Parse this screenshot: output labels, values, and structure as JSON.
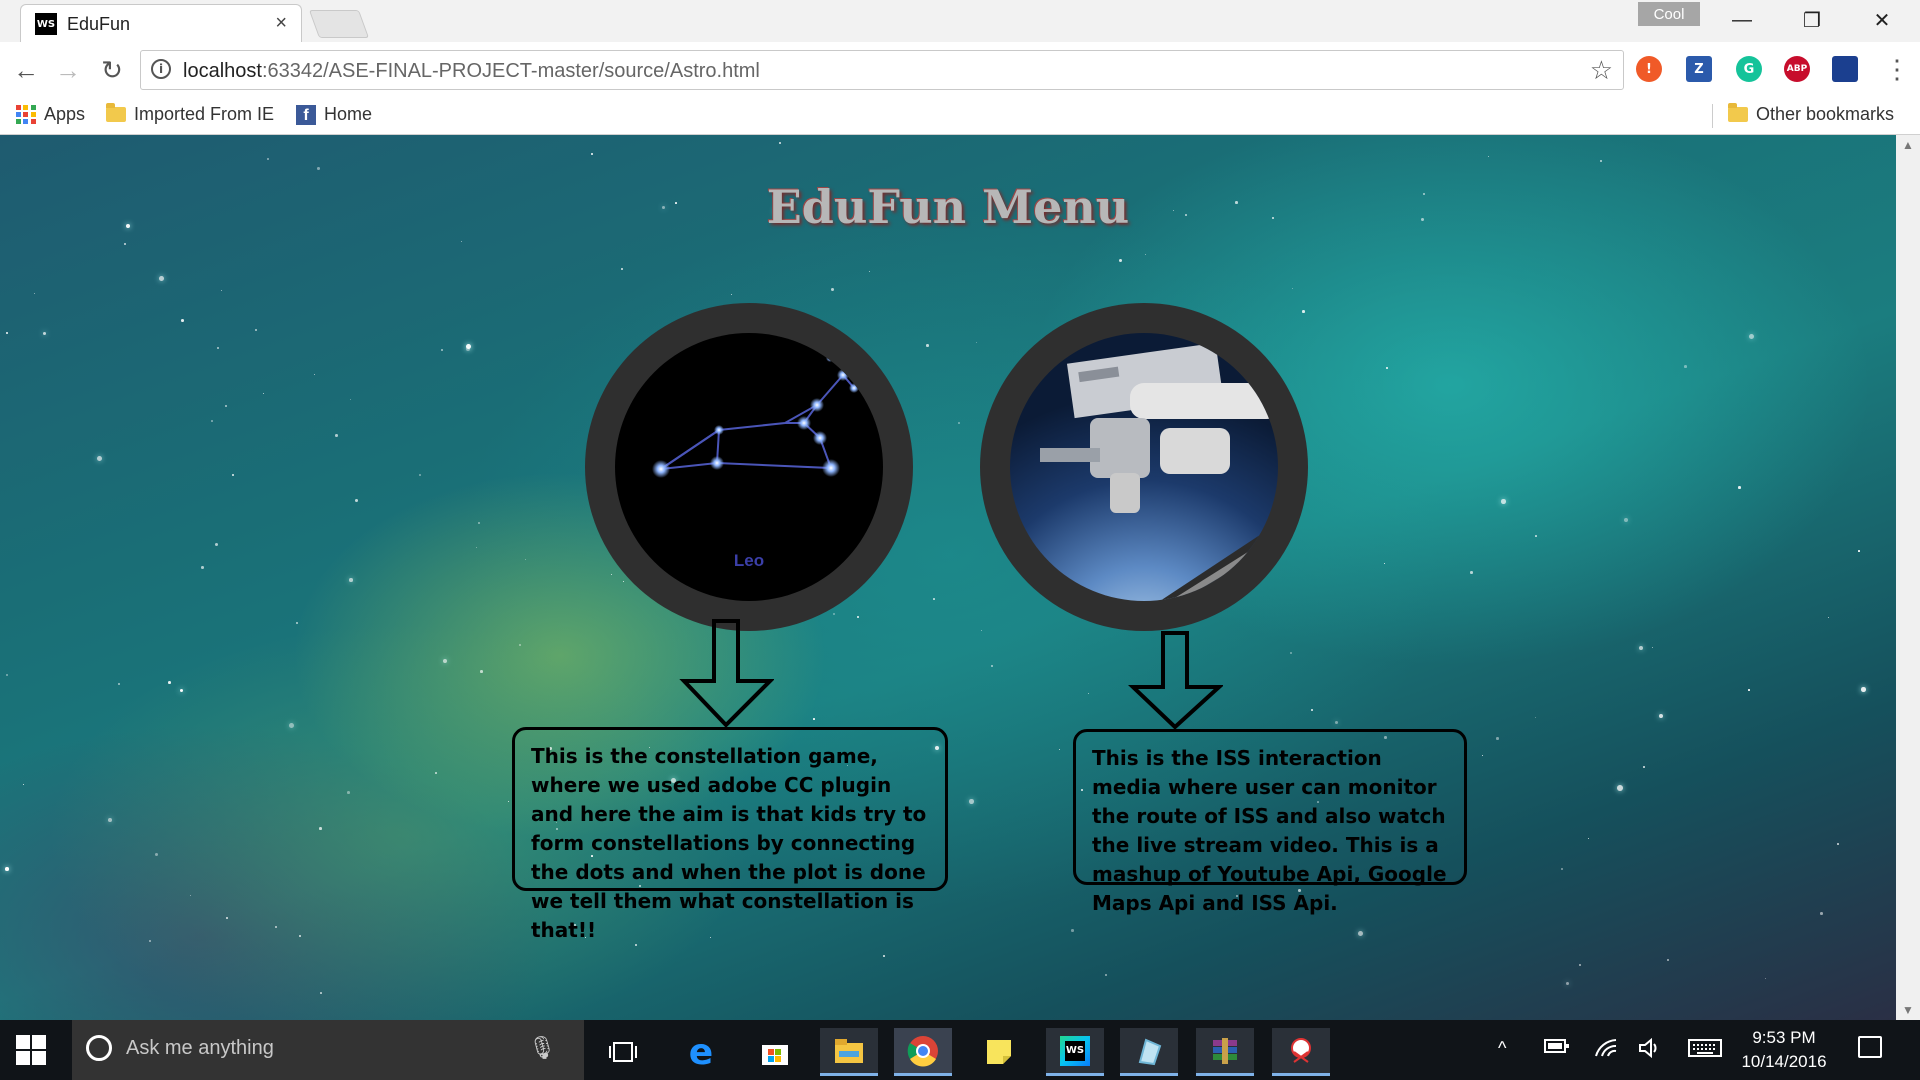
{
  "window": {
    "tab_title": "EduFun",
    "tab_favicon": "WS",
    "tab_close": "×",
    "profile_name": "Cool",
    "controls": {
      "minimize": "—",
      "restore": "❐",
      "close": "✕"
    }
  },
  "toolbar": {
    "url_host": "localhost",
    "url_rest": ":63342/ASE-FINAL-PROJECT-master/source/Astro.html",
    "extensions": [
      {
        "name": "alert-extension",
        "glyph": "!",
        "color": "#f05a28"
      },
      {
        "name": "zotero-extension",
        "glyph": "Z",
        "color": "#2b5aab"
      },
      {
        "name": "grammarly-extension",
        "glyph": "G",
        "color": "#15c39a"
      },
      {
        "name": "adblock-plus-extension",
        "glyph": "ABP",
        "color": "#c70d2c"
      },
      {
        "name": "flag-extension",
        "glyph": "",
        "color": "#1b3f8f"
      }
    ]
  },
  "bookmarks": {
    "apps": "Apps",
    "imported": "Imported From IE",
    "home": "Home",
    "other": "Other bookmarks"
  },
  "page": {
    "title": "EduFun Menu",
    "leo_label": "Leo",
    "constellation_description": "This is the constellation game, where we used adobe CC plugin and here the aim is that kids try to form constellations by connecting the dots and when the plot is done we tell them what constellation is that!!",
    "iss_description": "This is the ISS interaction media where user can monitor the route of ISS and also watch the live stream video. This is a  mashup of Youtube Api, Google Maps Api and ISS Api."
  },
  "taskbar": {
    "search_placeholder": "Ask me anything",
    "time": "9:53 PM",
    "date": "10/14/2016",
    "pinned": [
      "task-view",
      "edge",
      "store",
      "file-explorer",
      "chrome",
      "sticky-notes",
      "webstorm",
      "paint",
      "winrar",
      "snipping-tool"
    ]
  },
  "colors": {
    "accent_blue": "#7fb2e8",
    "title_text": "#b7b7b7",
    "ring": "#2f2f2f"
  }
}
